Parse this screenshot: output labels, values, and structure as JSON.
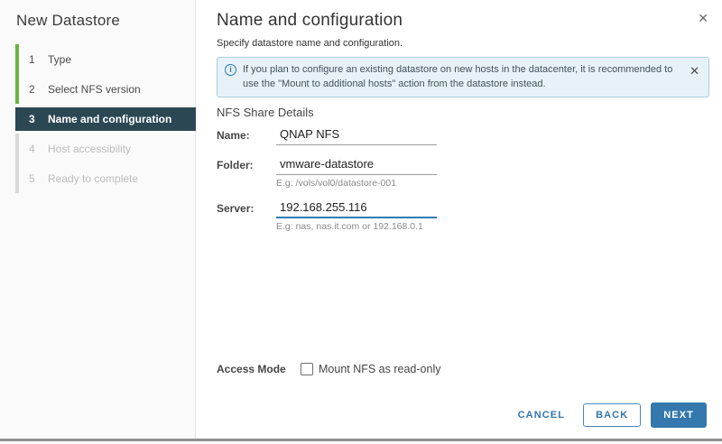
{
  "dialog": {
    "title": "New Datastore",
    "close_icon": "✕"
  },
  "sidebar": {
    "steps": [
      {
        "number": "1",
        "label": "Type",
        "state": "completed"
      },
      {
        "number": "2",
        "label": "Select NFS version",
        "state": "completed"
      },
      {
        "number": "3",
        "label": "Name and configuration",
        "state": "active"
      },
      {
        "number": "4",
        "label": "Host accessibility",
        "state": "pending"
      },
      {
        "number": "5",
        "label": "Ready to complete",
        "state": "pending"
      }
    ]
  },
  "header": {
    "title": "Name and configuration",
    "subtitle": "Specify datastore name and configuration."
  },
  "banner": {
    "icon": "i",
    "text": "If you plan to configure an existing datastore on new hosts in the datacenter, it is recommended to use the \"Mount to additional hosts\" action from the datastore instead.",
    "close_icon": "✕"
  },
  "form": {
    "section_title": "NFS Share Details",
    "fields": [
      {
        "label": "Name:",
        "value": "QNAP NFS",
        "helper": ""
      },
      {
        "label": "Folder:",
        "value": "vmware-datastore",
        "helper": "E.g: /vols/vol0/datastore-001"
      },
      {
        "label": "Server:",
        "value": "192.168.255.116",
        "helper": "E.g: nas, nas.it.com or 192.168.0.1"
      }
    ],
    "access_mode": {
      "label": "Access Mode",
      "checkbox_label": "Mount NFS as read-only",
      "checked": false
    }
  },
  "footer": {
    "cancel_label": "CANCEL",
    "back_label": "BACK",
    "next_label": "NEXT"
  },
  "colors": {
    "accent_blue": "#3478ad",
    "step_active_bg": "#2b4753",
    "step_complete_green": "#6cb344",
    "step_pending_gray": "#d8d8d8",
    "banner_bg": "#e7f2f8",
    "banner_border": "#a9cedd",
    "focus_underline": "#2f7db2"
  }
}
